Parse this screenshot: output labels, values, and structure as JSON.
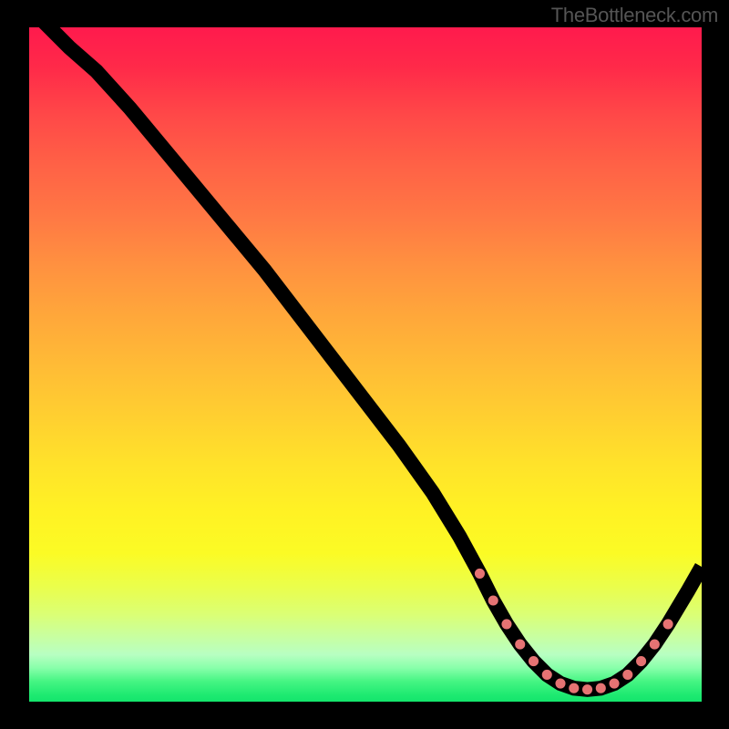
{
  "watermark": "TheBottleneck.com",
  "chart_data": {
    "type": "line",
    "title": "",
    "xlabel": "",
    "ylabel": "",
    "xlim": [
      0,
      100
    ],
    "ylim": [
      0,
      100
    ],
    "grid": false,
    "legend": false,
    "series": [
      {
        "name": "bottleneck-curve",
        "x": [
          2,
          6,
          10,
          15,
          20,
          25,
          30,
          35,
          40,
          45,
          50,
          55,
          60,
          64,
          67,
          69,
          71,
          73,
          75,
          77,
          79,
          81,
          83,
          85,
          87,
          89,
          91,
          93,
          95,
          98,
          100
        ],
        "y": [
          101,
          97,
          93.5,
          88,
          82,
          76,
          70,
          64,
          57.5,
          51,
          44.5,
          38,
          31,
          24.5,
          19,
          15,
          11.5,
          8.5,
          6,
          4,
          2.7,
          2,
          1.8,
          2,
          2.7,
          4,
          6,
          8.5,
          11.5,
          16.5,
          20
        ]
      }
    ],
    "markers": {
      "name": "optimal-range",
      "x": [
        67,
        69,
        71,
        73,
        75,
        77,
        79,
        81,
        83,
        85,
        87,
        89,
        91,
        93,
        95
      ],
      "y": [
        19,
        15,
        11.5,
        8.5,
        6,
        4,
        2.7,
        2,
        1.8,
        2,
        2.7,
        4,
        6,
        8.5,
        11.5
      ],
      "color": "#e57373"
    }
  }
}
